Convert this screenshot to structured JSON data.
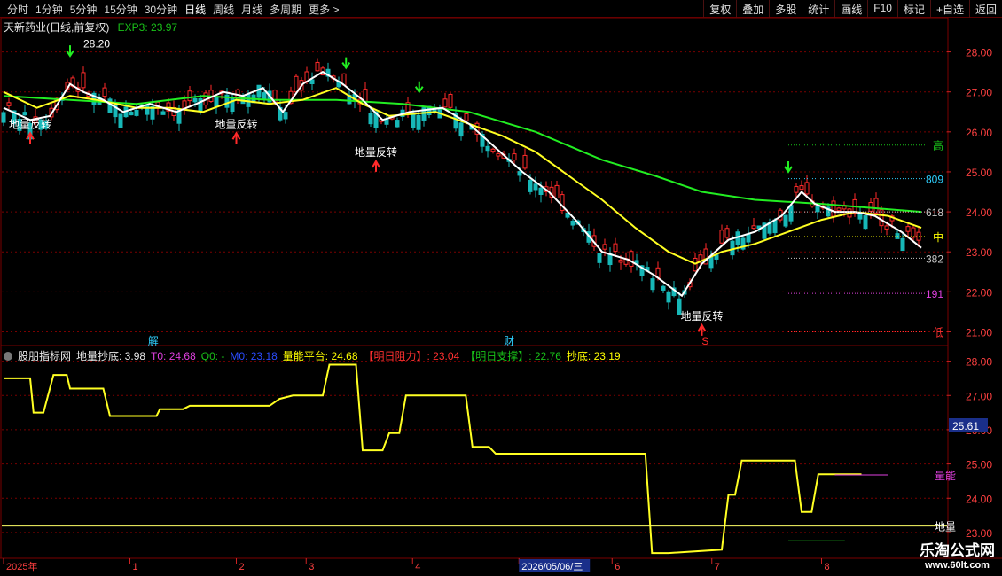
{
  "toolbar": {
    "periods": [
      "分时",
      "1分钟",
      "5分钟",
      "15分钟",
      "30分钟",
      "日线",
      "周线",
      "月线",
      "多周期",
      "更多 >"
    ],
    "active_index": 5,
    "right_buttons": [
      "复权",
      "叠加",
      "多股",
      "统计",
      "画线",
      "F10",
      "标记",
      "+自选",
      "返回"
    ]
  },
  "main_title": {
    "stock": "天新药业(日线,前复权)",
    "exp_label": "EXP3: 23.97"
  },
  "indicator_title": {
    "name": "股朋指标网",
    "items": [
      {
        "text": "地量抄底: 3.98",
        "color": "#e8e8e8"
      },
      {
        "text": "T0: 24.68",
        "color": "#e040e0"
      },
      {
        "text": "Q0: -",
        "color": "#19c219"
      },
      {
        "text": "M0: 23.18",
        "color": "#2a4cff"
      },
      {
        "text": "量能平台: 24.68",
        "color": "#ffff00"
      },
      {
        "text": "【明日阻力】: 23.04",
        "color": "#ff3030"
      },
      {
        "text": "【明日支撑】: 22.76",
        "color": "#19c219"
      },
      {
        "text": "抄底: 23.19",
        "color": "#ffff00"
      }
    ]
  },
  "annotations": {
    "high_price": "28.20",
    "reversal_label": "地量反转",
    "jie": "解",
    "cai": "财",
    "s_marker": "S"
  },
  "fib_labels": [
    {
      "text": "高",
      "color": "#19c219",
      "price": 25.67
    },
    {
      "text": "809",
      "color": "#2fd0ff",
      "price": 24.83
    },
    {
      "text": "618",
      "color": "#c8c8c8",
      "price": 24.0
    },
    {
      "text": "中",
      "color": "#ffff00",
      "price": 23.38
    },
    {
      "text": "382",
      "color": "#c8c8c8",
      "price": 22.84
    },
    {
      "text": "191",
      "color": "#e040e0",
      "price": 21.96
    },
    {
      "text": "低",
      "color": "#ff3030",
      "price": 21.0
    }
  ],
  "date_axis": {
    "labels": [
      "2025年",
      "1",
      "2",
      "3",
      "4",
      "2026/05/06/三",
      "6",
      "7",
      "8"
    ]
  },
  "sub_right_labels": {
    "cursor_value": "25.61",
    "lbl1": "量能",
    "lbl2": "地量"
  },
  "logo": {
    "line1": "乐淘公式网",
    "line2": "www.60lt.com"
  },
  "colors": {
    "up": "#ff2a2a",
    "down": "#17b8b8",
    "ma_fast": "#ffffff",
    "ma_mid": "#ffff22",
    "ma_slow": "#22ee22",
    "grid": "#7a0000"
  },
  "chart_data": [
    {
      "type": "line",
      "title": "天新药业(日线,前复权)",
      "y_ticks": [
        21.0,
        22.0,
        23.0,
        24.0,
        25.0,
        26.0,
        27.0,
        28.0
      ],
      "ylim": [
        20.7,
        28.5
      ],
      "n_bars": 175,
      "ma_white": [
        [
          0,
          26.6
        ],
        [
          8,
          26.3
        ],
        [
          14,
          26.4
        ],
        [
          20,
          27.2
        ],
        [
          24,
          27.0
        ],
        [
          30,
          26.8
        ],
        [
          36,
          26.5
        ],
        [
          44,
          26.7
        ],
        [
          52,
          26.5
        ],
        [
          58,
          26.7
        ],
        [
          66,
          27.0
        ],
        [
          72,
          26.9
        ],
        [
          78,
          27.1
        ],
        [
          84,
          26.5
        ],
        [
          90,
          27.2
        ],
        [
          96,
          27.5
        ],
        [
          102,
          27.2
        ],
        [
          108,
          26.8
        ],
        [
          114,
          26.3
        ],
        [
          122,
          26.5
        ],
        [
          132,
          26.6
        ],
        [
          140,
          26.2
        ],
        [
          148,
          25.6
        ],
        [
          156,
          25.0
        ],
        [
          164,
          24.5
        ],
        [
          172,
          23.8
        ],
        [
          180,
          23.0
        ],
        [
          188,
          22.8
        ],
        [
          196,
          22.4
        ],
        [
          204,
          21.9
        ],
        [
          210,
          22.7
        ],
        [
          218,
          23.3
        ],
        [
          226,
          23.5
        ],
        [
          234,
          23.9
        ],
        [
          240,
          24.5
        ],
        [
          244,
          24.2
        ],
        [
          250,
          24.0
        ],
        [
          256,
          24.0
        ],
        [
          262,
          23.9
        ],
        [
          270,
          23.5
        ],
        [
          276,
          23.1
        ]
      ],
      "ma_yellow": [
        [
          0,
          27.0
        ],
        [
          10,
          26.6
        ],
        [
          20,
          26.9
        ],
        [
          28,
          26.8
        ],
        [
          40,
          26.6
        ],
        [
          50,
          26.6
        ],
        [
          60,
          26.5
        ],
        [
          70,
          26.8
        ],
        [
          80,
          26.7
        ],
        [
          90,
          26.8
        ],
        [
          100,
          27.1
        ],
        [
          108,
          26.7
        ],
        [
          116,
          26.4
        ],
        [
          130,
          26.5
        ],
        [
          140,
          26.2
        ],
        [
          150,
          25.9
        ],
        [
          160,
          25.5
        ],
        [
          170,
          24.9
        ],
        [
          180,
          24.3
        ],
        [
          190,
          23.6
        ],
        [
          200,
          23.0
        ],
        [
          208,
          22.7
        ],
        [
          216,
          23.0
        ],
        [
          226,
          23.2
        ],
        [
          236,
          23.5
        ],
        [
          246,
          23.8
        ],
        [
          256,
          24.0
        ],
        [
          266,
          23.9
        ],
        [
          276,
          23.6
        ]
      ],
      "ma_green": [
        [
          0,
          26.9
        ],
        [
          20,
          26.8
        ],
        [
          40,
          26.7
        ],
        [
          60,
          26.9
        ],
        [
          80,
          26.8
        ],
        [
          100,
          26.8
        ],
        [
          120,
          26.7
        ],
        [
          140,
          26.5
        ],
        [
          160,
          26.0
        ],
        [
          180,
          25.3
        ],
        [
          196,
          24.9
        ],
        [
          210,
          24.5
        ],
        [
          226,
          24.3
        ],
        [
          246,
          24.2
        ],
        [
          276,
          24.0
        ]
      ]
    },
    {
      "type": "line",
      "title": "股朋指标网",
      "y_ticks": [
        23.0,
        24.0,
        25.0,
        26.0,
        27.0,
        28.0
      ],
      "ylim": [
        22.3,
        28.3
      ],
      "series": [
        {
          "name": "抄底",
          "values": [
            [
              0,
              27.5
            ],
            [
              8,
              27.5
            ],
            [
              9,
              26.5
            ],
            [
              12,
              26.5
            ],
            [
              15,
              27.6
            ],
            [
              19,
              27.6
            ],
            [
              20,
              27.2
            ],
            [
              30,
              27.2
            ],
            [
              32,
              26.4
            ],
            [
              46,
              26.4
            ],
            [
              47,
              26.6
            ],
            [
              54,
              26.6
            ],
            [
              56,
              26.7
            ],
            [
              80,
              26.7
            ],
            [
              83,
              26.9
            ],
            [
              87,
              27.0
            ],
            [
              96,
              27.0
            ],
            [
              98,
              27.9
            ],
            [
              106,
              27.9
            ],
            [
              108,
              25.4
            ],
            [
              114,
              25.4
            ],
            [
              116,
              25.9
            ],
            [
              119,
              25.9
            ],
            [
              121,
              27.0
            ],
            [
              139,
              27.0
            ],
            [
              141,
              25.5
            ],
            [
              146,
              25.5
            ],
            [
              148,
              25.3
            ],
            [
              193,
              25.3
            ],
            [
              195,
              22.4
            ],
            [
              200,
              22.4
            ],
            [
              216,
              22.5
            ],
            [
              218,
              24.1
            ],
            [
              220,
              24.1
            ],
            [
              222,
              25.1
            ],
            [
              238,
              25.1
            ],
            [
              240,
              23.6
            ],
            [
              243,
              23.6
            ],
            [
              245,
              24.7
            ],
            [
              258,
              24.7
            ]
          ]
        }
      ],
      "hline_value": 23.19
    }
  ]
}
